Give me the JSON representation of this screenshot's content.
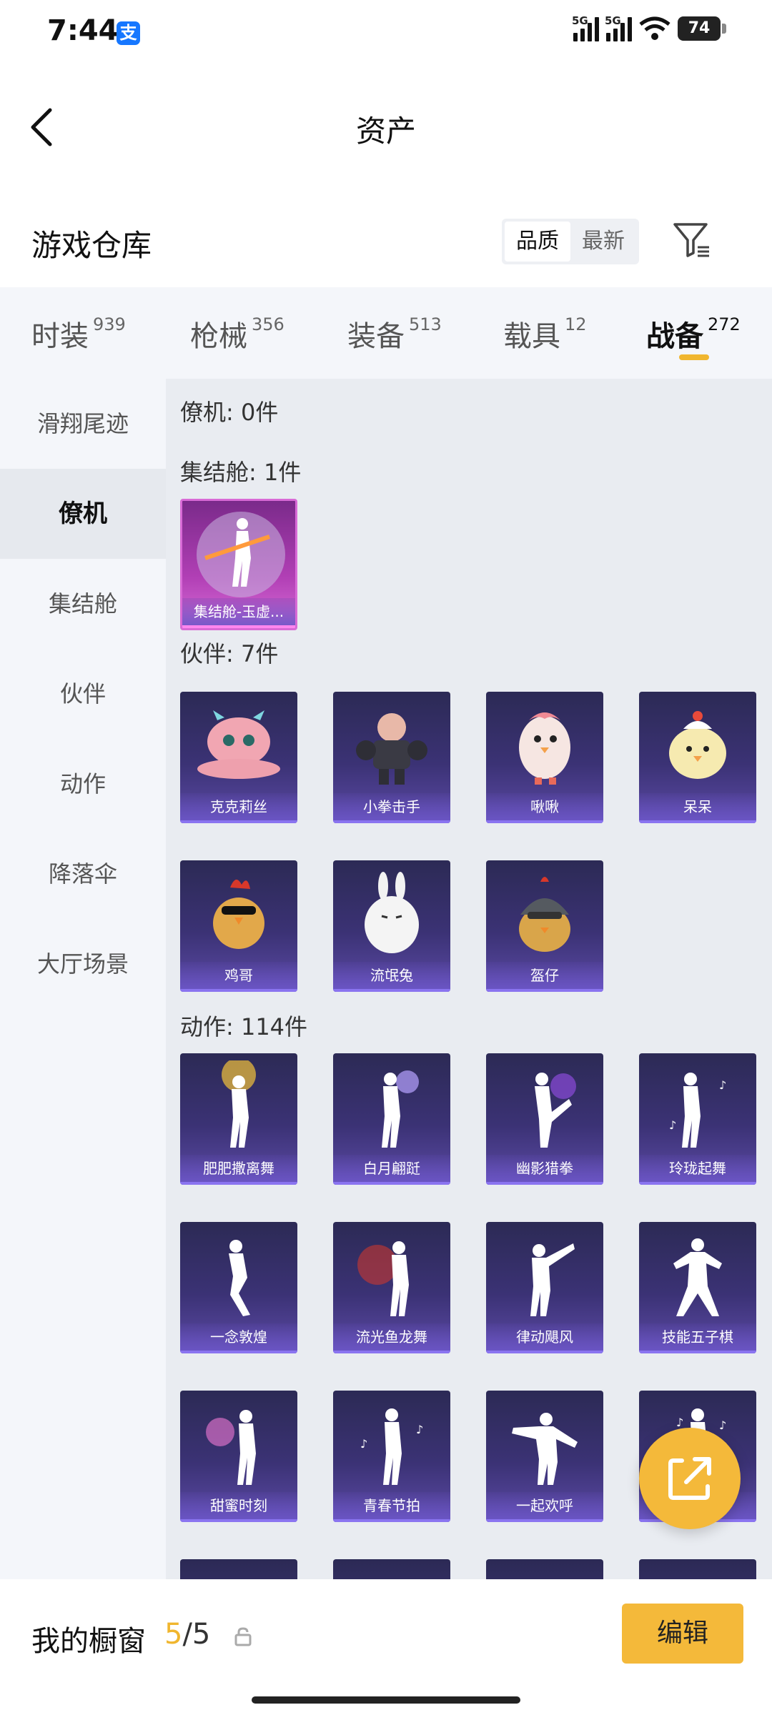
{
  "status": {
    "time": "7:44",
    "alipay": "支",
    "net1": "5G",
    "net2": "5G",
    "battery": "74"
  },
  "header": {
    "title": "资产"
  },
  "warehouse": {
    "title": "游戏仓库",
    "sort_options": [
      "品质",
      "最新"
    ],
    "sort_active": "品质"
  },
  "tabs": [
    {
      "label": "时装",
      "count": "939"
    },
    {
      "label": "枪械",
      "count": "356"
    },
    {
      "label": "装备",
      "count": "513"
    },
    {
      "label": "载具",
      "count": "12"
    },
    {
      "label": "战备",
      "count": "272"
    }
  ],
  "active_tab": "战备",
  "sidebar": [
    {
      "label": "滑翔尾迹"
    },
    {
      "label": "僚机"
    },
    {
      "label": "集结舱"
    },
    {
      "label": "伙伴"
    },
    {
      "label": "动作"
    },
    {
      "label": "降落伞"
    },
    {
      "label": "大厅场景"
    }
  ],
  "active_sidebar": "僚机",
  "sections": {
    "wingman": {
      "title": "僚机: 0件"
    },
    "capsule": {
      "title": "集结舱: 1件",
      "items": [
        "集结舱-玉虚..."
      ]
    },
    "partner": {
      "title": "伙伴: 7件",
      "items": [
        "克克莉丝",
        "小拳击手",
        "啾啾",
        "呆呆",
        "鸡哥",
        "流氓兔",
        "盔仔"
      ]
    },
    "action": {
      "title": "动作: 114件",
      "items": [
        "肥肥撒离舞",
        "白月翩跹",
        "幽影猎拳",
        "玲珑起舞",
        "一念敦煌",
        "流光鱼龙舞",
        "律动飓风",
        "技能五子棋",
        "甜蜜时刻",
        "青春节拍",
        "一起欢呼",
        ""
      ]
    }
  },
  "showcase": {
    "title": "我的橱窗",
    "current": "5",
    "total": "/5",
    "edit_label": "编辑"
  },
  "colors": {
    "accent": "#f4b93a",
    "card_dark": "#2c2a55",
    "card_purple": "#b13fb5"
  }
}
